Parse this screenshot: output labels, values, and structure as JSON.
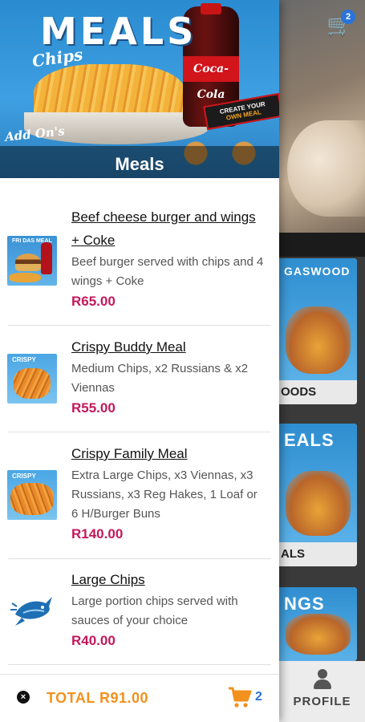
{
  "background": {
    "cart_badge": "2",
    "categories": [
      {
        "art_text": "GASWOOD",
        "label": "OODS"
      },
      {
        "art_text": "EALS",
        "label": "ALS"
      },
      {
        "art_text": "NGS",
        "label": ""
      }
    ],
    "nav": {
      "profile_label": "PROFILE"
    }
  },
  "drawer": {
    "banner": {
      "logo": "MEALS",
      "script_top": "Chips",
      "script_bottom": "Add On's",
      "bottle_label": "Coca-Cola",
      "tag_line1": "CREATE YOUR",
      "tag_line2": "OWN MEAL",
      "title": "Meals"
    },
    "items": [
      {
        "name": "Beef cheese burger and wings + Coke",
        "description": "Beef burger served with chips and 4 wings + Coke",
        "price": "R65.00",
        "thumb_text": "FRI DAS MEAL"
      },
      {
        "name": "Crispy Buddy Meal",
        "description": "Medium Chips, x2 Russians & x2 Viennas",
        "price": "R55.00",
        "thumb_text": "CRISPY"
      },
      {
        "name": "Crispy Family Meal",
        "description": "Extra Large Chips, x3 Viennas, x3 Russians, x3 Reg Hakes, 1 Loaf or 6 H/Burger Buns",
        "price": "R140.00",
        "thumb_text": "CRISPY"
      },
      {
        "name": "Large Chips",
        "description": "Large portion chips served with sauces of your choice",
        "price": "R40.00",
        "thumb_text": ""
      }
    ],
    "footer": {
      "total": "TOTAL R91.00",
      "cart_count": "2",
      "close_glyph": "×"
    }
  },
  "colors": {
    "price": "#c2185b",
    "total": "#f2911e",
    "cart_icon": "#f2911e",
    "count": "#2a73d9"
  }
}
